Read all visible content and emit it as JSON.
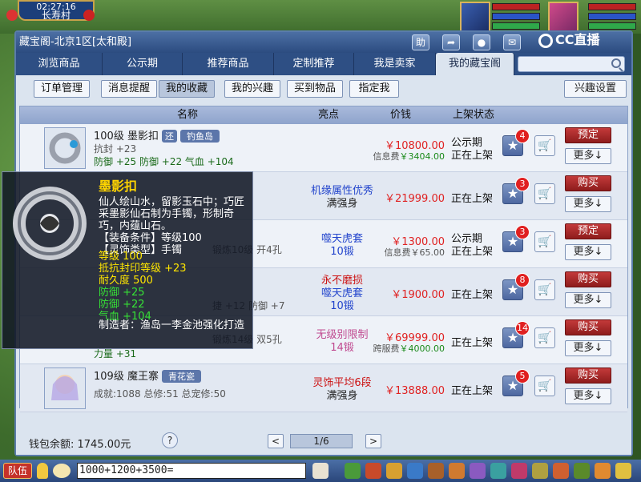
{
  "hud": {
    "time": "02:27:16",
    "location": "长寿村"
  },
  "brand": {
    "cc_text": "CC直播"
  },
  "window": {
    "title": "藏宝阁-北京1区[太和殿]",
    "toolbar_icons": [
      "help-icon",
      "share-icon",
      "record-icon",
      "chat-icon",
      "minimize-icon",
      "close-icon"
    ],
    "toolbar_labels": {
      "help": "助",
      "share": "➦",
      "record": "●",
      "chat": "✉",
      "minimize": "—",
      "close": "✕"
    }
  },
  "tabs": [
    "浏览商品",
    "公示期",
    "推荐商品",
    "定制推荐",
    "我是卖家",
    "我的藏宝阁"
  ],
  "active_tab": 5,
  "search": {
    "placeholder": ""
  },
  "subtabs": [
    "订单管理",
    "消息提醒",
    "我的收藏",
    "我的兴趣",
    "买到物品",
    "指定我"
  ],
  "active_subtab": 2,
  "interest_button": "兴趣设置",
  "table": {
    "headers": {
      "name": "名称",
      "feature": "亮点",
      "price": "价钱",
      "status": "上架状态"
    },
    "rows": [
      {
        "name": "100级 墨影扣",
        "tag": "还",
        "server": "钓鱼岛",
        "stat1": "抗封 +23",
        "stat2": "防御 +25 防御 +22 气血 +104",
        "feature1": "",
        "feature2": "",
        "price": "￥10800.00",
        "fee_label": "信息费",
        "fee": "￥3404.00",
        "status1": "公示期",
        "status2": "正在上架",
        "fav_count": "4",
        "action": "预定",
        "more": "更多↓"
      },
      {
        "name": "",
        "tag": "",
        "server": "",
        "stat1": "",
        "stat2": "",
        "feature1": "机缘属性优秀",
        "feature2": "满强身",
        "price": "￥21999.00",
        "fee_label": "",
        "fee": "",
        "status1": "正在上架",
        "status2": "",
        "fav_count": "3",
        "action": "购买",
        "more": "更多↓"
      },
      {
        "name": "",
        "tag": "",
        "server": "",
        "stat1": "",
        "stat2": "锻炼10级 开4孔",
        "feature1": "噬天虎套",
        "feature2": "10锻",
        "price": "￥1300.00",
        "fee_label": "信息费",
        "fee": "￥65.00",
        "status1": "公示期",
        "status2": "正在上架",
        "fav_count": "3",
        "action": "预定",
        "more": "更多↓"
      },
      {
        "name": "",
        "tag": "",
        "server": "",
        "stat1": "",
        "stat2": "捷 +12 防御 +7",
        "feature1": "永不磨损",
        "feature2": "噬天虎套",
        "feature3": "10锻",
        "price": "￥1900.00",
        "fee_label": "",
        "fee": "",
        "status1": "正在上架",
        "status2": "",
        "fav_count": "8",
        "action": "购买",
        "more": "更多↓"
      },
      {
        "name": "",
        "tag": "",
        "server": "",
        "stat1": "锻炼14级 双5孔",
        "stat2": "力量 +31",
        "feature1": "无级别限制",
        "feature2": "14锻",
        "price": "￥69999.00",
        "fee_label": "跨服费",
        "fee": "￥4000.00",
        "status1": "正在上架",
        "status2": "",
        "fav_count": "14",
        "action": "购买",
        "more": "更多↓"
      },
      {
        "name": "109级 魔王寨",
        "tag": "",
        "server": "青花瓷",
        "stat1": "成就:1088 总修:51 总宠修:50",
        "stat2": "",
        "feature1": "灵饰平均6段",
        "feature2": "满强身",
        "price": "￥13888.00",
        "fee_label": "",
        "fee": "",
        "status1": "正在上架",
        "status2": "",
        "fav_count": "5",
        "action": "购买",
        "more": "更多↓"
      }
    ]
  },
  "footer": {
    "wallet": "钱包余额: 1745.00元",
    "help": "?",
    "prev": "<",
    "page": "1/6",
    "next": ">"
  },
  "tooltip": {
    "title": "墨影扣",
    "desc": "仙人绘山水，留影玉石中；巧匠采墨影仙石制为手镯，形制奇巧，内蕴山石。",
    "type1": "【装备条件】等级100",
    "type2": "【灵饰类型】手镯",
    "level": "等级 100",
    "seal": "抵抗封印等级 +23",
    "durability": "耐久度 500",
    "def1": "防御 +25",
    "def2": "防御 +22",
    "hp": "气血 +104",
    "maker": "制造者：渔岛一李金池强化打造"
  },
  "chat": {
    "team_label": "队伍",
    "input_value": "1000+1200+3500="
  },
  "colors": {
    "accent": "#2e4f84",
    "price": "#e02222",
    "buy": "#c33a3a"
  }
}
